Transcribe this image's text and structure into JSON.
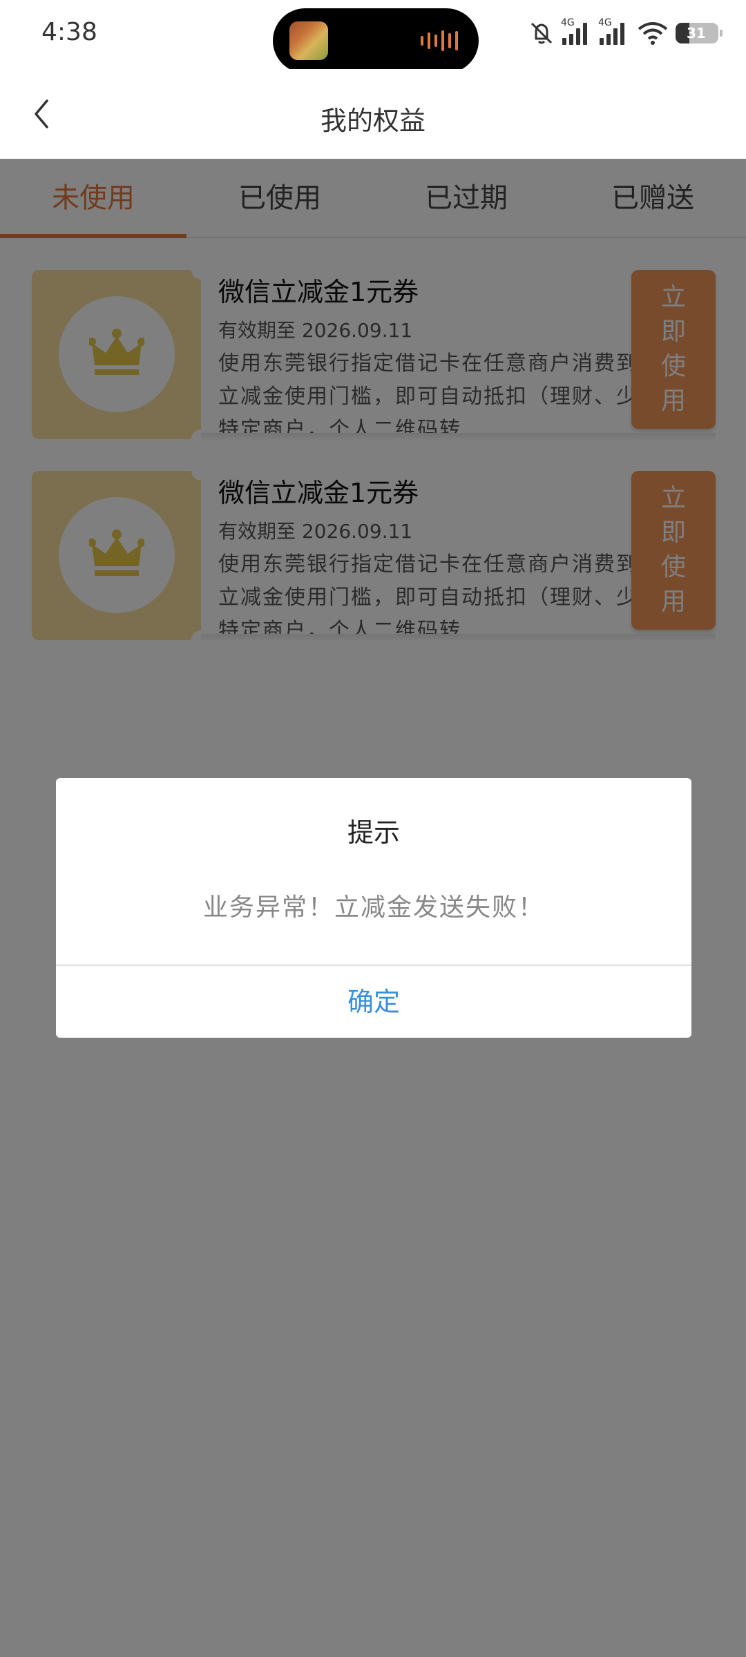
{
  "status_bar": {
    "time": "4:38",
    "network_1": "4G",
    "network_2": "4G",
    "battery": "31"
  },
  "header": {
    "title": "我的权益"
  },
  "tabs": [
    {
      "label": "未使用",
      "active": true
    },
    {
      "label": "已使用",
      "active": false
    },
    {
      "label": "已过期",
      "active": false
    },
    {
      "label": "已赠送",
      "active": false
    }
  ],
  "coupons": [
    {
      "name": "微信立减金1元券",
      "expiry": "有效期至 2026.09.11",
      "description": "使用东莞银行指定借记卡在任意商户消费到满立减金使用门槛，即可自动抵扣（理财、少数特定商户，个人二维码转",
      "button_chars": [
        "立",
        "即",
        "使",
        "用"
      ]
    },
    {
      "name": "微信立减金1元券",
      "expiry": "有效期至 2026.09.11",
      "description": "使用东莞银行指定借记卡在任意商户消费到满立减金使用门槛，即可自动抵扣（理财、少数特定商户，个人二维码转",
      "button_chars": [
        "立",
        "即",
        "使",
        "用"
      ]
    }
  ],
  "dialog": {
    "title": "提示",
    "message": "业务异常！立减金发送失败！",
    "confirm_label": "确定"
  },
  "colors": {
    "accent": "#e0783a",
    "button": "#f0965a",
    "coupon_bg": "#f7dfa0",
    "crown": "#e8c84a",
    "link": "#3a8fdc"
  }
}
